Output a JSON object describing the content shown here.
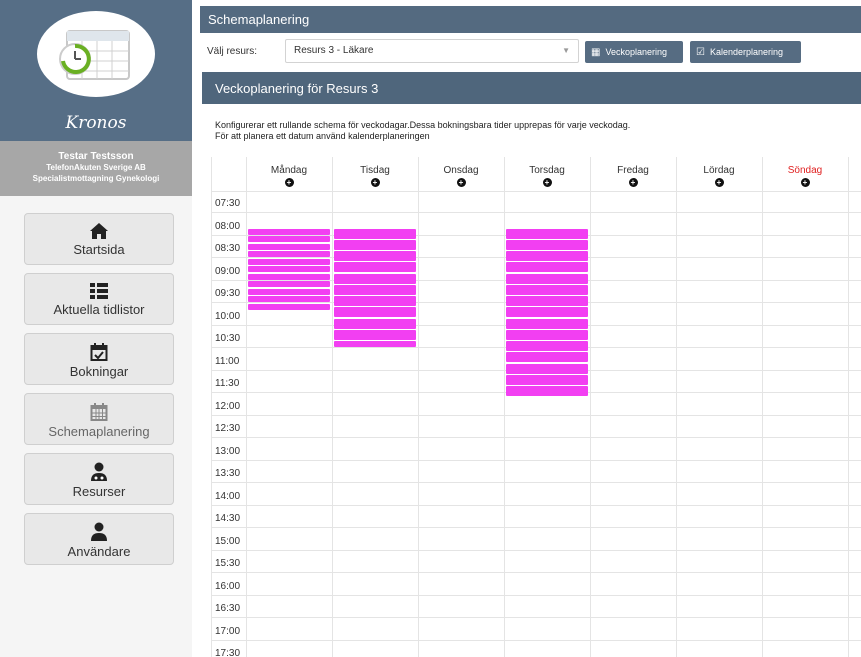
{
  "app": {
    "name": "Kronos"
  },
  "user": {
    "name": "Testar Testsson",
    "org": "TelefonAkuten Sverige AB",
    "unit": "Specialistmottagning Gynekologi"
  },
  "nav": [
    {
      "label": "Startsida",
      "icon": "home-icon"
    },
    {
      "label": "Aktuella tidlistor",
      "icon": "list-icon"
    },
    {
      "label": "Bokningar",
      "icon": "calendar-check-icon"
    },
    {
      "label": "Schemaplanering",
      "icon": "calendar-grid-icon",
      "active": true
    },
    {
      "label": "Resurser",
      "icon": "doctor-icon"
    },
    {
      "label": "Användare",
      "icon": "user-icon"
    }
  ],
  "topbar": {
    "title": "Schemaplanering"
  },
  "resource": {
    "label": "Välj resurs:",
    "selected": "Resurs 3 - Läkare"
  },
  "buttons": {
    "week": "Veckoplanering",
    "calendar": "Kalenderplanering"
  },
  "panel": {
    "title": "Veckoplanering för Resurs 3",
    "desc1": "Konfigurerar ett rullande schema för veckodagar.Dessa bokningsbara tider upprepas för varje veckodag.",
    "desc2": "För att planera ett datum använd kalenderplaneringen"
  },
  "days": [
    "Måndag",
    "Tisdag",
    "Onsdag",
    "Torsdag",
    "Fredag",
    "Lördag",
    "Söndag"
  ],
  "sunday_color": "#e02020",
  "times": [
    "07:30",
    "08:00",
    "08:30",
    "09:00",
    "09:30",
    "10:00",
    "10:30",
    "11:00",
    "11:30",
    "12:00",
    "12:30",
    "13:00",
    "13:30",
    "14:00",
    "14:30",
    "15:00",
    "15:30",
    "16:00",
    "16:30",
    "17:00",
    "17:30"
  ],
  "slot_color": "#f23ff2",
  "bookable": [
    {
      "day": "Måndag",
      "start": "08:00",
      "end": "09:50",
      "minutes": 10
    },
    {
      "day": "Tisdag",
      "start": "08:00",
      "end": "10:40",
      "minutes": 15
    },
    {
      "day": "Torsdag",
      "start": "08:00",
      "end": "11:45",
      "minutes": 15
    }
  ]
}
